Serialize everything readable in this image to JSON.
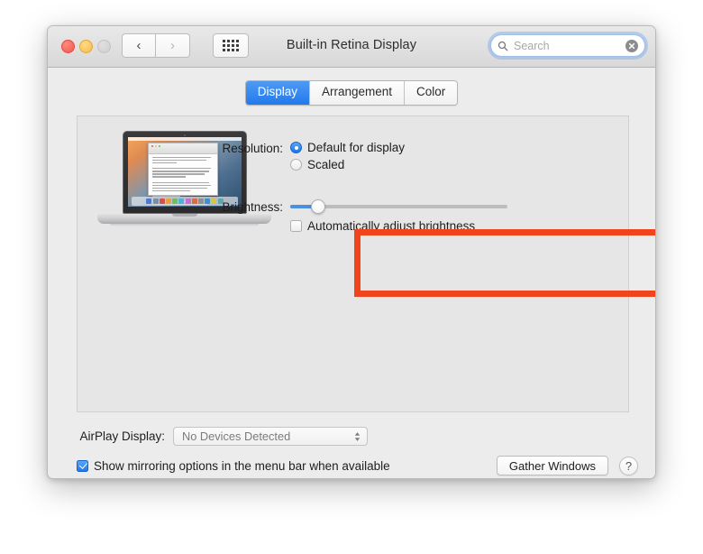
{
  "window": {
    "title": "Built-in Retina Display",
    "traffic_lights": [
      "close",
      "minimize",
      "zoom"
    ],
    "nav": {
      "back": "‹",
      "forward": "›"
    },
    "grid_button": "show-all-preferences"
  },
  "search": {
    "placeholder": "Search",
    "value": "",
    "clear_label": "✕"
  },
  "tabs": [
    {
      "label": "Display",
      "active": true
    },
    {
      "label": "Arrangement",
      "active": false
    },
    {
      "label": "Color",
      "active": false
    }
  ],
  "resolution": {
    "label": "Resolution:",
    "options": [
      {
        "label": "Default for display",
        "selected": true
      },
      {
        "label": "Scaled",
        "selected": false
      }
    ]
  },
  "brightness": {
    "label": "Brightness:",
    "slider_value": 13,
    "slider_min": 0,
    "slider_max": 100,
    "auto_adjust": {
      "label": "Automatically adjust brightness",
      "checked": false
    },
    "highlight_color": "#f0441c"
  },
  "airplay": {
    "label": "AirPlay Display:",
    "selected": "No Devices Detected",
    "options": [
      "No Devices Detected"
    ],
    "chevron_up": "▴",
    "chevron_down": "▾"
  },
  "bottom": {
    "mirroring": {
      "label": "Show mirroring options in the menu bar when available",
      "checked": true
    },
    "gather_windows_label": "Gather Windows",
    "help_label": "?"
  },
  "preview": {
    "device": "macbook-pro",
    "dock_colors": [
      "#4a79d8",
      "#7b8fa8",
      "#d94f4f",
      "#e8a33d",
      "#6fbf5a",
      "#4fb0e0",
      "#c96fc9",
      "#e06a3d",
      "#8f8f96",
      "#3f8fd0",
      "#d8c24a",
      "#5fa8a8"
    ],
    "titlebar_dots": [
      "#f2564b",
      "#f5bd4a",
      "#62c554"
    ]
  },
  "colors": {
    "accent_blue": "#2279ec",
    "annotation_red": "#f0441c",
    "window_bg": "#ececec",
    "panel_bg": "#e6e6e6"
  }
}
